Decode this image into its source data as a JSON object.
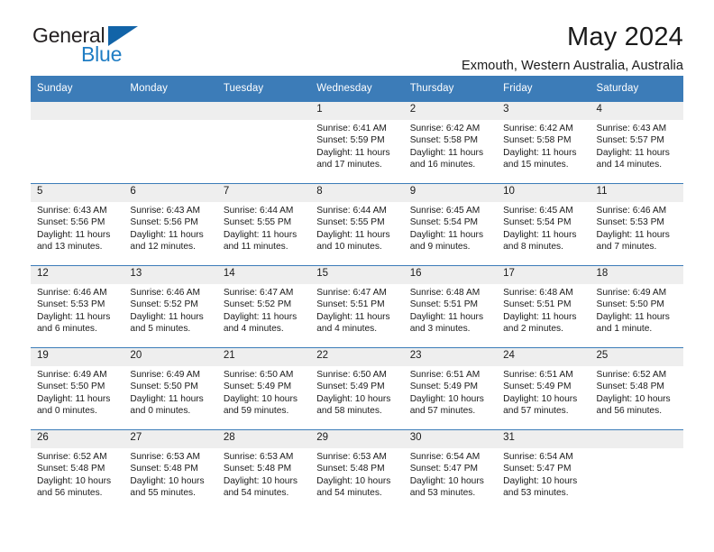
{
  "branding": {
    "name_top": "General",
    "name_bottom": "Blue"
  },
  "header": {
    "title": "May 2024",
    "subtitle": "Exmouth, Western Australia, Australia"
  },
  "colors": {
    "header_blue": "#3c7cb8",
    "logo_blue": "#1f7dc4",
    "daynum_gray": "#eeeeee"
  },
  "weekday_headers": [
    "Sunday",
    "Monday",
    "Tuesday",
    "Wednesday",
    "Thursday",
    "Friday",
    "Saturday"
  ],
  "weeks": [
    [
      {
        "day": "",
        "lines": []
      },
      {
        "day": "",
        "lines": []
      },
      {
        "day": "",
        "lines": []
      },
      {
        "day": "1",
        "lines": [
          "Sunrise: 6:41 AM",
          "Sunset: 5:59 PM",
          "Daylight: 11 hours",
          "and 17 minutes."
        ]
      },
      {
        "day": "2",
        "lines": [
          "Sunrise: 6:42 AM",
          "Sunset: 5:58 PM",
          "Daylight: 11 hours",
          "and 16 minutes."
        ]
      },
      {
        "day": "3",
        "lines": [
          "Sunrise: 6:42 AM",
          "Sunset: 5:58 PM",
          "Daylight: 11 hours",
          "and 15 minutes."
        ]
      },
      {
        "day": "4",
        "lines": [
          "Sunrise: 6:43 AM",
          "Sunset: 5:57 PM",
          "Daylight: 11 hours",
          "and 14 minutes."
        ]
      }
    ],
    [
      {
        "day": "5",
        "lines": [
          "Sunrise: 6:43 AM",
          "Sunset: 5:56 PM",
          "Daylight: 11 hours",
          "and 13 minutes."
        ]
      },
      {
        "day": "6",
        "lines": [
          "Sunrise: 6:43 AM",
          "Sunset: 5:56 PM",
          "Daylight: 11 hours",
          "and 12 minutes."
        ]
      },
      {
        "day": "7",
        "lines": [
          "Sunrise: 6:44 AM",
          "Sunset: 5:55 PM",
          "Daylight: 11 hours",
          "and 11 minutes."
        ]
      },
      {
        "day": "8",
        "lines": [
          "Sunrise: 6:44 AM",
          "Sunset: 5:55 PM",
          "Daylight: 11 hours",
          "and 10 minutes."
        ]
      },
      {
        "day": "9",
        "lines": [
          "Sunrise: 6:45 AM",
          "Sunset: 5:54 PM",
          "Daylight: 11 hours",
          "and 9 minutes."
        ]
      },
      {
        "day": "10",
        "lines": [
          "Sunrise: 6:45 AM",
          "Sunset: 5:54 PM",
          "Daylight: 11 hours",
          "and 8 minutes."
        ]
      },
      {
        "day": "11",
        "lines": [
          "Sunrise: 6:46 AM",
          "Sunset: 5:53 PM",
          "Daylight: 11 hours",
          "and 7 minutes."
        ]
      }
    ],
    [
      {
        "day": "12",
        "lines": [
          "Sunrise: 6:46 AM",
          "Sunset: 5:53 PM",
          "Daylight: 11 hours",
          "and 6 minutes."
        ]
      },
      {
        "day": "13",
        "lines": [
          "Sunrise: 6:46 AM",
          "Sunset: 5:52 PM",
          "Daylight: 11 hours",
          "and 5 minutes."
        ]
      },
      {
        "day": "14",
        "lines": [
          "Sunrise: 6:47 AM",
          "Sunset: 5:52 PM",
          "Daylight: 11 hours",
          "and 4 minutes."
        ]
      },
      {
        "day": "15",
        "lines": [
          "Sunrise: 6:47 AM",
          "Sunset: 5:51 PM",
          "Daylight: 11 hours",
          "and 4 minutes."
        ]
      },
      {
        "day": "16",
        "lines": [
          "Sunrise: 6:48 AM",
          "Sunset: 5:51 PM",
          "Daylight: 11 hours",
          "and 3 minutes."
        ]
      },
      {
        "day": "17",
        "lines": [
          "Sunrise: 6:48 AM",
          "Sunset: 5:51 PM",
          "Daylight: 11 hours",
          "and 2 minutes."
        ]
      },
      {
        "day": "18",
        "lines": [
          "Sunrise: 6:49 AM",
          "Sunset: 5:50 PM",
          "Daylight: 11 hours",
          "and 1 minute."
        ]
      }
    ],
    [
      {
        "day": "19",
        "lines": [
          "Sunrise: 6:49 AM",
          "Sunset: 5:50 PM",
          "Daylight: 11 hours",
          "and 0 minutes."
        ]
      },
      {
        "day": "20",
        "lines": [
          "Sunrise: 6:49 AM",
          "Sunset: 5:50 PM",
          "Daylight: 11 hours",
          "and 0 minutes."
        ]
      },
      {
        "day": "21",
        "lines": [
          "Sunrise: 6:50 AM",
          "Sunset: 5:49 PM",
          "Daylight: 10 hours",
          "and 59 minutes."
        ]
      },
      {
        "day": "22",
        "lines": [
          "Sunrise: 6:50 AM",
          "Sunset: 5:49 PM",
          "Daylight: 10 hours",
          "and 58 minutes."
        ]
      },
      {
        "day": "23",
        "lines": [
          "Sunrise: 6:51 AM",
          "Sunset: 5:49 PM",
          "Daylight: 10 hours",
          "and 57 minutes."
        ]
      },
      {
        "day": "24",
        "lines": [
          "Sunrise: 6:51 AM",
          "Sunset: 5:49 PM",
          "Daylight: 10 hours",
          "and 57 minutes."
        ]
      },
      {
        "day": "25",
        "lines": [
          "Sunrise: 6:52 AM",
          "Sunset: 5:48 PM",
          "Daylight: 10 hours",
          "and 56 minutes."
        ]
      }
    ],
    [
      {
        "day": "26",
        "lines": [
          "Sunrise: 6:52 AM",
          "Sunset: 5:48 PM",
          "Daylight: 10 hours",
          "and 56 minutes."
        ]
      },
      {
        "day": "27",
        "lines": [
          "Sunrise: 6:53 AM",
          "Sunset: 5:48 PM",
          "Daylight: 10 hours",
          "and 55 minutes."
        ]
      },
      {
        "day": "28",
        "lines": [
          "Sunrise: 6:53 AM",
          "Sunset: 5:48 PM",
          "Daylight: 10 hours",
          "and 54 minutes."
        ]
      },
      {
        "day": "29",
        "lines": [
          "Sunrise: 6:53 AM",
          "Sunset: 5:48 PM",
          "Daylight: 10 hours",
          "and 54 minutes."
        ]
      },
      {
        "day": "30",
        "lines": [
          "Sunrise: 6:54 AM",
          "Sunset: 5:47 PM",
          "Daylight: 10 hours",
          "and 53 minutes."
        ]
      },
      {
        "day": "31",
        "lines": [
          "Sunrise: 6:54 AM",
          "Sunset: 5:47 PM",
          "Daylight: 10 hours",
          "and 53 minutes."
        ]
      },
      {
        "day": "",
        "lines": []
      }
    ]
  ]
}
